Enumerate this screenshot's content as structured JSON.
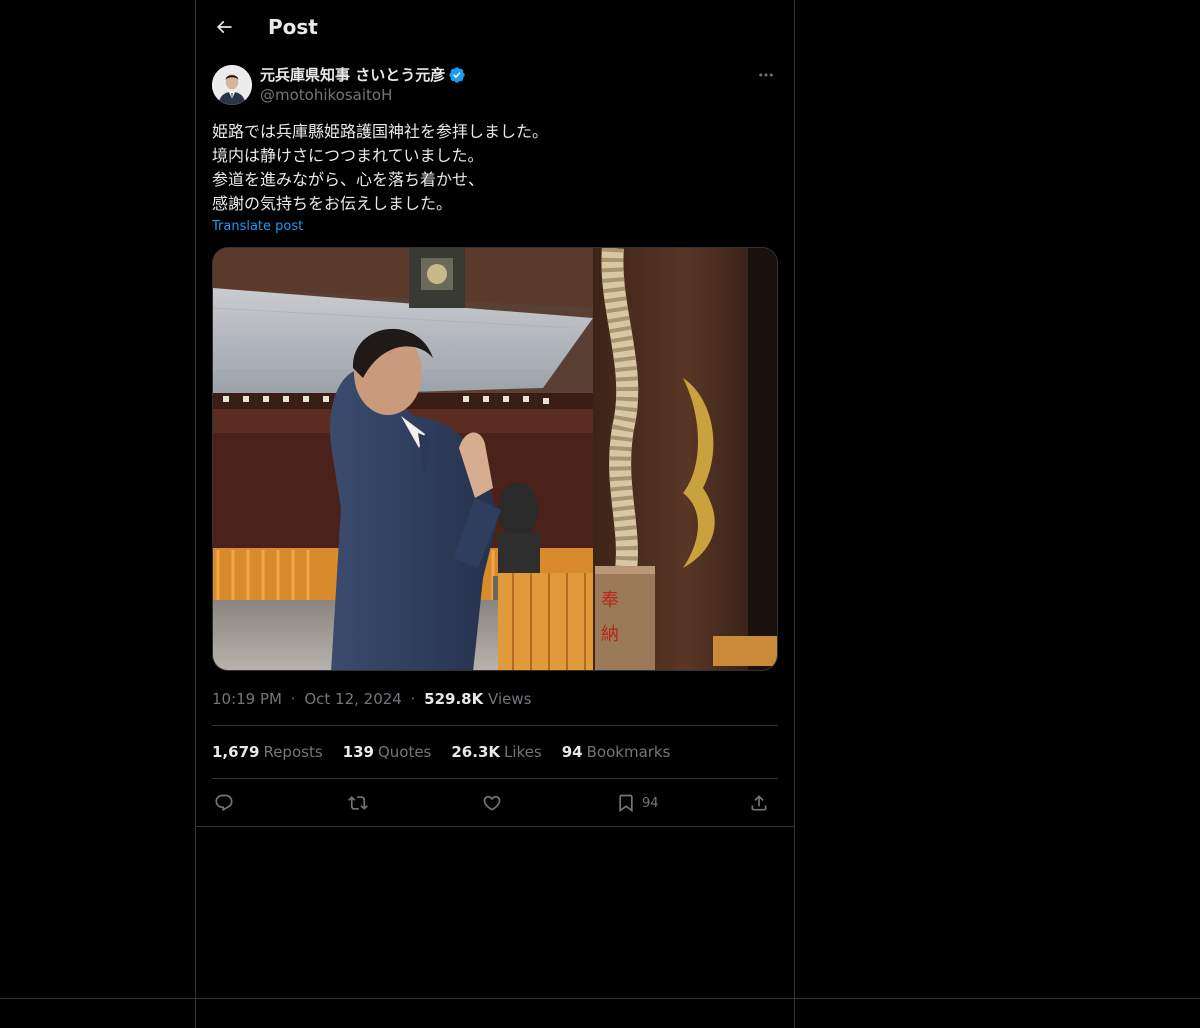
{
  "header": {
    "title": "Post"
  },
  "author": {
    "name": "元兵庫県知事 さいとう元彦",
    "handle": "@motohikosaitoH"
  },
  "post": {
    "lines": [
      "姫路では兵庫縣姫路護国神社を参拝しました。",
      "境内は静けさにつつまれていました。",
      "参道を進みながら、心を落ち着かせ、",
      "感謝の気持ちをお伝えしました。"
    ],
    "translate_label": "Translate post",
    "media_stamp": [
      "奉",
      "納"
    ]
  },
  "meta": {
    "time": "10:19 PM",
    "dot1": "·",
    "date": "Oct 12, 2024",
    "dot2": "·",
    "views_count": "529.8K",
    "views_label": "Views"
  },
  "stats": {
    "reposts_count": "1,679",
    "reposts_label": "Reposts",
    "quotes_count": "139",
    "quotes_label": "Quotes",
    "likes_count": "26.3K",
    "likes_label": "Likes",
    "bookmarks_count": "94",
    "bookmarks_label": "Bookmarks"
  },
  "actions": {
    "bookmark_count": "94"
  },
  "colors": {
    "background": "#000000",
    "text": "#e7e9ea",
    "secondary": "#71767b",
    "accent": "#1d9bf0",
    "border": "#2f3336"
  },
  "icons": [
    "back-arrow-icon",
    "verified-badge-icon",
    "more-icon",
    "reply-icon",
    "repost-icon",
    "like-icon",
    "bookmark-icon",
    "share-icon"
  ]
}
